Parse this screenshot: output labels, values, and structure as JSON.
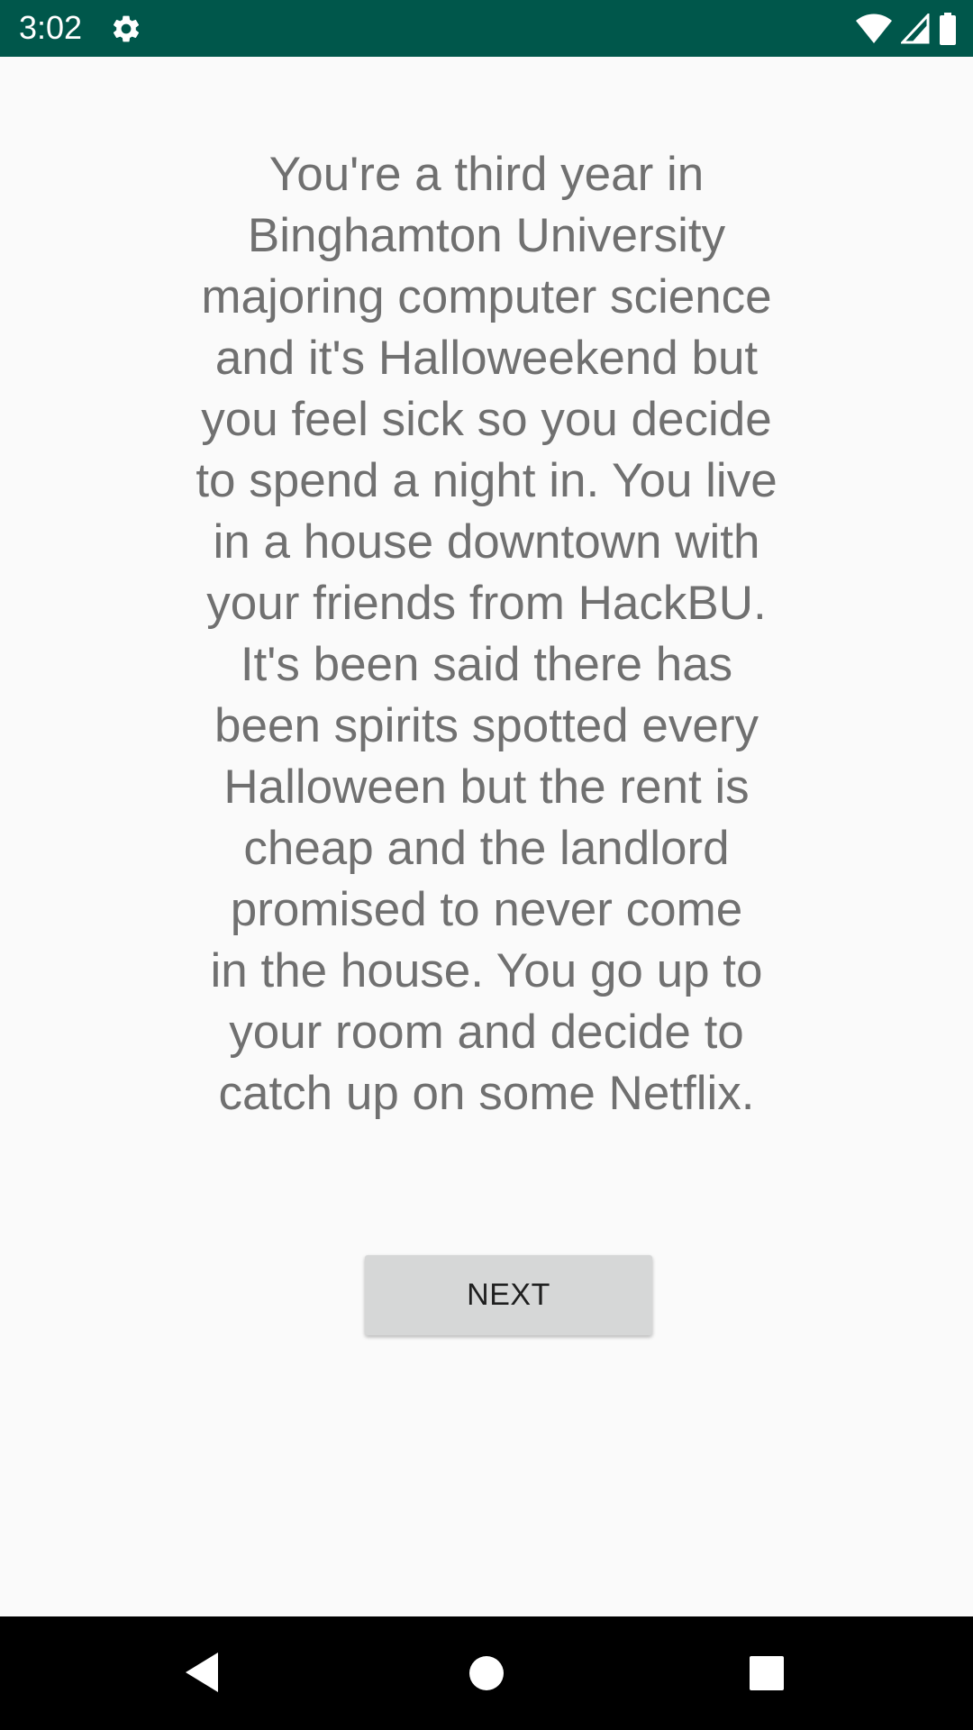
{
  "status_bar": {
    "time": "3:02",
    "icons": [
      "settings-icon",
      "wifi-icon",
      "cell-signal-icon",
      "battery-icon"
    ],
    "background_color": "#00574b"
  },
  "main": {
    "story_text": "You're a third year in\nBinghamton University\nmajoring computer science\nand it's Halloweekend but\nyou feel sick so you decide\nto spend a night in. You live\nin a house downtown with\nyour friends from HackBU.\nIt's been said there has\nbeen spirits spotted every\nHalloween but the rent is\ncheap and the landlord\npromised to never come\nin the house. You go up to\nyour room and decide to\ncatch up on some Netflix.",
    "next_button_label": "NEXT"
  },
  "nav_bar": {
    "icons": [
      "back-icon",
      "home-icon",
      "recents-icon"
    ]
  }
}
